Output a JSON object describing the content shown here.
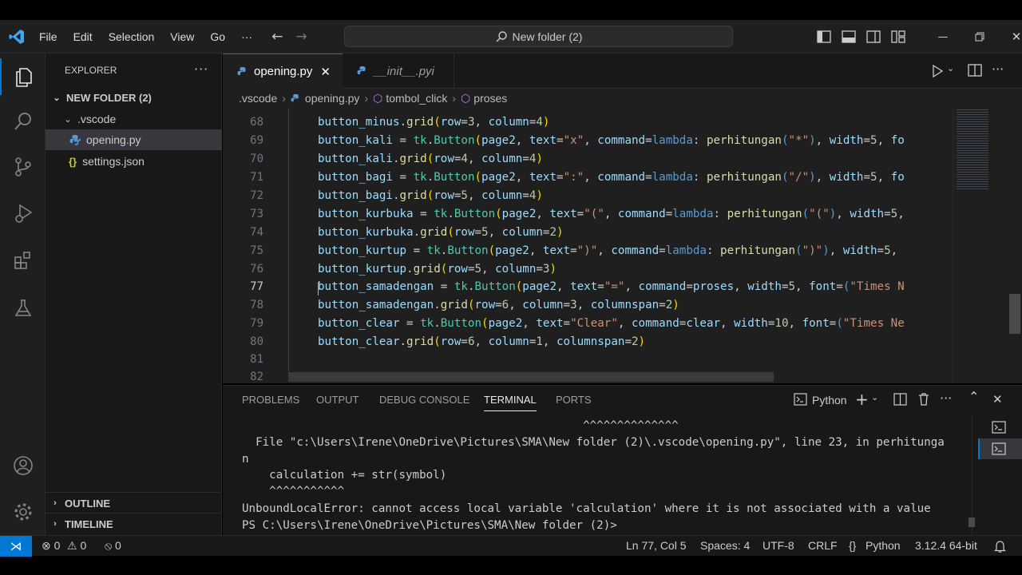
{
  "menu": [
    "File",
    "Edit",
    "Selection",
    "View",
    "Go",
    "···"
  ],
  "command_center": "New folder (2)",
  "sidebar": {
    "header": "EXPLORER",
    "root": "NEW FOLDER (2)",
    "folder": ".vscode",
    "files": [
      "opening.py",
      "settings.json"
    ],
    "outline": "OUTLINE",
    "timeline": "TIMELINE"
  },
  "tabs": [
    {
      "label": "opening.py",
      "close": "✕"
    },
    {
      "label": "__init__.pyi"
    }
  ],
  "breadcrumb": [
    ".vscode",
    "opening.py",
    "tombol_click",
    "proses"
  ],
  "editor": {
    "line_numbers": [
      "68",
      "69",
      "70",
      "71",
      "72",
      "73",
      "74",
      "75",
      "76",
      "77",
      "78",
      "79",
      "80",
      "81",
      "82"
    ]
  },
  "panel": {
    "tabs": [
      "PROBLEMS",
      "OUTPUT",
      "DEBUG CONSOLE",
      "TERMINAL",
      "PORTS"
    ],
    "profile": "Python",
    "lines": [
      "                                                  ^^^^^^^^^^^^^^",
      "  File \"c:\\Users\\Irene\\OneDrive\\Pictures\\SMA\\New folder (2)\\.vscode\\opening.py\", line 23, in perhitunga",
      "n",
      "    calculation += str(symbol)",
      "    ^^^^^^^^^^^",
      "UnboundLocalError: cannot access local variable 'calculation' where it is not associated with a value",
      "PS C:\\Users\\Irene\\OneDrive\\Pictures\\SMA\\New folder (2)>"
    ]
  },
  "status": {
    "errors": "0",
    "warnings": "0",
    "ports": "0",
    "position": "Ln 77, Col 5",
    "spaces": "Spaces: 4",
    "encoding": "UTF-8",
    "eol": "CRLF",
    "language": "Python",
    "interpreter": "3.12.4 64-bit"
  },
  "colors": {
    "accent": "#0078d4",
    "keyword": "#569cd6",
    "string": "#ce9178",
    "variable": "#9cdcfe",
    "function": "#dcdcaa"
  }
}
